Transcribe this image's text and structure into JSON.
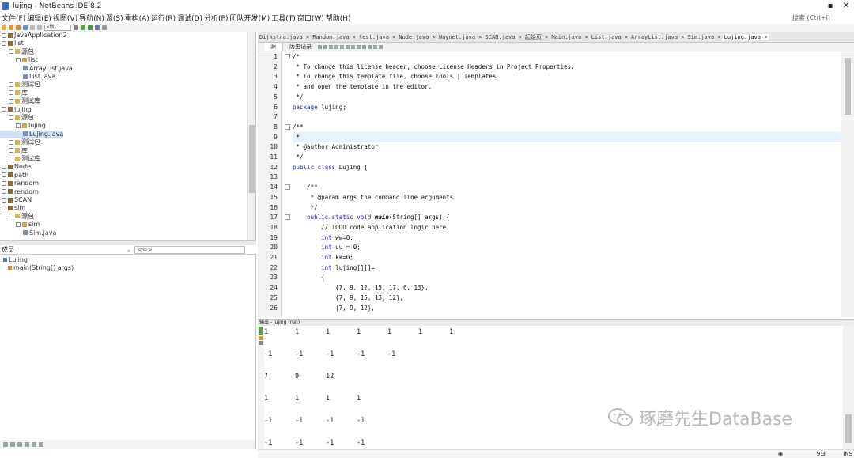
{
  "window": {
    "title": "lujing - NetBeans IDE 8.2",
    "buttons": [
      "▪",
      "✕"
    ]
  },
  "menubar": [
    "文件(F)",
    "编辑(E)",
    "视图(V)",
    "导航(N)",
    "源(S)",
    "重构(A)",
    "运行(R)",
    "调试(D)",
    "分析(P)",
    "团队开发(M)",
    "工具(T)",
    "窗口(W)",
    "帮助(H)"
  ],
  "search": {
    "placeholder": "搜索 (Ctrl+I)"
  },
  "toolbar": {
    "config_combo": "<默..."
  },
  "projects": [
    {
      "label": "JavaApplication2",
      "indent": 0,
      "icon": "proj",
      "toggle": "-"
    },
    {
      "label": "list",
      "indent": 0,
      "icon": "proj",
      "toggle": "-"
    },
    {
      "label": "源包",
      "indent": 1,
      "icon": "folder",
      "toggle": "-"
    },
    {
      "label": "list",
      "indent": 2,
      "icon": "pkg",
      "toggle": "-"
    },
    {
      "label": "ArrayList.java",
      "indent": 3,
      "icon": "file",
      "toggle": ""
    },
    {
      "label": "List.java",
      "indent": 3,
      "icon": "file",
      "toggle": ""
    },
    {
      "label": "测试包",
      "indent": 1,
      "icon": "folder",
      "toggle": "+"
    },
    {
      "label": "库",
      "indent": 1,
      "icon": "folder",
      "toggle": "+"
    },
    {
      "label": "测试库",
      "indent": 1,
      "icon": "folder",
      "toggle": "+"
    },
    {
      "label": "lujing",
      "indent": 0,
      "icon": "proj",
      "toggle": "-"
    },
    {
      "label": "源包",
      "indent": 1,
      "icon": "folder",
      "toggle": "-"
    },
    {
      "label": "lujing",
      "indent": 2,
      "icon": "pkg",
      "toggle": "-"
    },
    {
      "label": "Lujing.java",
      "indent": 3,
      "icon": "file",
      "toggle": "",
      "selected": true
    },
    {
      "label": "测试包",
      "indent": 1,
      "icon": "folder",
      "toggle": "+"
    },
    {
      "label": "库",
      "indent": 1,
      "icon": "folder",
      "toggle": "+"
    },
    {
      "label": "测试库",
      "indent": 1,
      "icon": "folder",
      "toggle": "+"
    },
    {
      "label": "Node",
      "indent": 0,
      "icon": "proj",
      "toggle": "+"
    },
    {
      "label": "path",
      "indent": 0,
      "icon": "proj",
      "toggle": "+"
    },
    {
      "label": "random",
      "indent": 0,
      "icon": "proj",
      "toggle": "+"
    },
    {
      "label": "rendom",
      "indent": 0,
      "icon": "proj",
      "toggle": "+"
    },
    {
      "label": "SCAN",
      "indent": 0,
      "icon": "proj",
      "toggle": "+"
    },
    {
      "label": "sim",
      "indent": 0,
      "icon": "proj",
      "toggle": "-"
    },
    {
      "label": "源包",
      "indent": 1,
      "icon": "folder",
      "toggle": "-"
    },
    {
      "label": "sim",
      "indent": 2,
      "icon": "pkg",
      "toggle": "-"
    },
    {
      "label": "Sim.java",
      "indent": 3,
      "icon": "file",
      "toggle": ""
    }
  ],
  "navigator": {
    "members_label": "成员",
    "filter_placeholder": "<空>",
    "items": [
      {
        "label": "Lujing",
        "indent": 0
      },
      {
        "label": "main(String[] args)",
        "indent": 1
      }
    ]
  },
  "editor_tabs": [
    "Dijkstra.java ×",
    "Random.java ×",
    "test.java ×",
    "Node.java ×",
    "Waynet.java ×",
    "SCAN.java ×",
    "起始页 ×",
    "Main.java ×",
    "List.java ×",
    "ArrayList.java ×",
    "Sim.java ×",
    "Lujing.java ×"
  ],
  "editor_toolbar": {
    "source": "源",
    "history": "历史记录"
  },
  "code_lines": [
    {
      "n": "1",
      "t": "/*",
      "c": "cmt",
      "fold": true
    },
    {
      "n": "2",
      "t": " * To change this license header, choose License Headers in Project Properties.",
      "c": "cmt"
    },
    {
      "n": "3",
      "t": " * To change this template file, choose Tools | Templates",
      "c": "cmt"
    },
    {
      "n": "4",
      "t": " * and open the template in the editor.",
      "c": "cmt"
    },
    {
      "n": "5",
      "t": " */",
      "c": "cmt"
    },
    {
      "n": "6",
      "t": "package lujing;",
      "c": "pkg"
    },
    {
      "n": "7",
      "t": "",
      "c": ""
    },
    {
      "n": "8",
      "t": "/**",
      "c": "cmt",
      "fold": true
    },
    {
      "n": "9",
      "t": " *",
      "c": "cmt",
      "hl": true
    },
    {
      "n": "10",
      "t": " * @author Administrator",
      "c": "cmt"
    },
    {
      "n": "11",
      "t": " */",
      "c": "cmt"
    },
    {
      "n": "12",
      "t": "public class Lujing {",
      "c": "cls"
    },
    {
      "n": "13",
      "t": "",
      "c": ""
    },
    {
      "n": "14",
      "t": "    /**",
      "c": "cmt",
      "fold": true
    },
    {
      "n": "15",
      "t": "     * @param args the command line arguments",
      "c": "cmt"
    },
    {
      "n": "16",
      "t": "     */",
      "c": "cmt"
    },
    {
      "n": "17",
      "t": "    public static void main(String[] args) {",
      "c": "main",
      "fold": true
    },
    {
      "n": "18",
      "t": "        // TODO code application logic here",
      "c": "cmt"
    },
    {
      "n": "19",
      "t": "        int ww=0;",
      "c": "int"
    },
    {
      "n": "20",
      "t": "        int uu = 0;",
      "c": "int"
    },
    {
      "n": "21",
      "t": "        int kk=0;",
      "c": "int"
    },
    {
      "n": "22",
      "t": "        int lujing[][]=",
      "c": "int"
    },
    {
      "n": "23",
      "t": "        {",
      "c": ""
    },
    {
      "n": "24",
      "t": "            {7, 9, 12, 15, 17, 6, 13},",
      "c": ""
    },
    {
      "n": "25",
      "t": "            {7, 9, 15, 13, 12},",
      "c": ""
    },
    {
      "n": "26",
      "t": "            {7, 9, 12},",
      "c": ""
    }
  ],
  "output": {
    "title": "输出 - lujing (run)",
    "lines": [
      [
        "1",
        "1",
        "1",
        "1",
        "1",
        "1",
        "1"
      ],
      [
        "-1",
        "-1",
        "-1",
        "-1",
        "-1"
      ],
      [
        "7",
        "9",
        "12"
      ],
      [
        "1",
        "1",
        "1",
        "1"
      ],
      [
        "-1",
        "-1",
        "-1",
        "-1"
      ],
      [
        "-1",
        "-1",
        "-1",
        "-1"
      ]
    ]
  },
  "watermark": "琢磨先生DataBase",
  "status": {
    "position": "9:3",
    "insert": "INS"
  }
}
